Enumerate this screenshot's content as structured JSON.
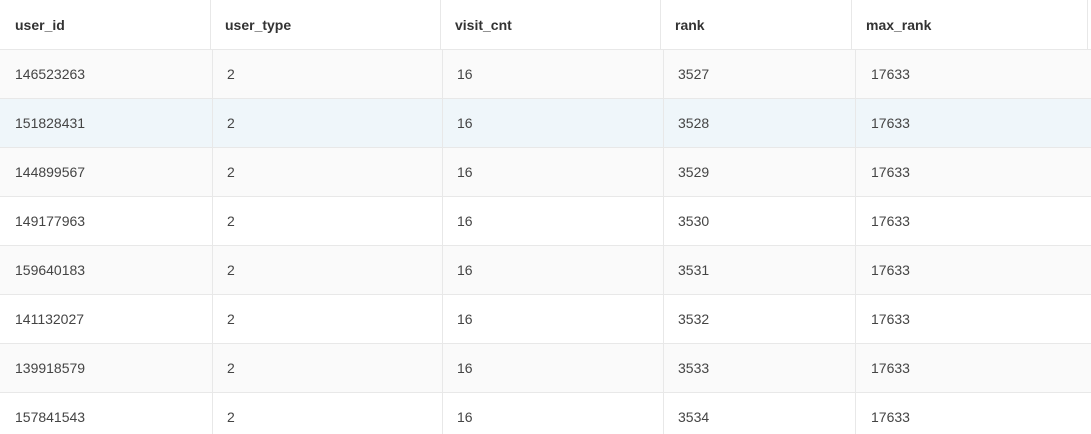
{
  "table": {
    "columns": [
      "user_id",
      "user_type",
      "visit_cnt",
      "rank",
      "max_rank"
    ],
    "rows": [
      [
        "146523263",
        "2",
        "16",
        "3527",
        "17633"
      ],
      [
        "151828431",
        "2",
        "16",
        "3528",
        "17633"
      ],
      [
        "144899567",
        "2",
        "16",
        "3529",
        "17633"
      ],
      [
        "149177963",
        "2",
        "16",
        "3530",
        "17633"
      ],
      [
        "159640183",
        "2",
        "16",
        "3531",
        "17633"
      ],
      [
        "141132027",
        "2",
        "16",
        "3532",
        "17633"
      ],
      [
        "139918579",
        "2",
        "16",
        "3533",
        "17633"
      ],
      [
        "157841543",
        "2",
        "16",
        "3534",
        "17633"
      ]
    ],
    "selected_row": 1
  },
  "colors": {
    "header_bg": "#ffffff",
    "row_even_bg": "#fafafa",
    "row_odd_bg": "#ffffff",
    "selected_bg": "#eff6fa",
    "border": "#e8e8e8"
  }
}
